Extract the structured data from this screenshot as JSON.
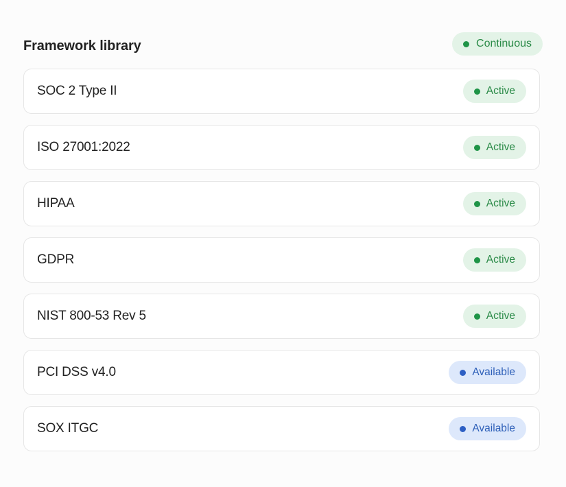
{
  "header": {
    "title": "Framework library",
    "status_label": "Continuous"
  },
  "frameworks": [
    {
      "name": "SOC 2 Type II",
      "status": "Active"
    },
    {
      "name": "ISO 27001:2022",
      "status": "Active"
    },
    {
      "name": "HIPAA",
      "status": "Active"
    },
    {
      "name": "GDPR",
      "status": "Active"
    },
    {
      "name": "NIST 800-53 Rev 5",
      "status": "Active"
    },
    {
      "name": "PCI DSS v4.0",
      "status": "Available"
    },
    {
      "name": "SOX ITGC",
      "status": "Available"
    }
  ],
  "colors": {
    "active_bg": "#e3f3e7",
    "active_text": "#2a8a47",
    "available_bg": "#dde8fb",
    "available_text": "#2d5fb8"
  }
}
